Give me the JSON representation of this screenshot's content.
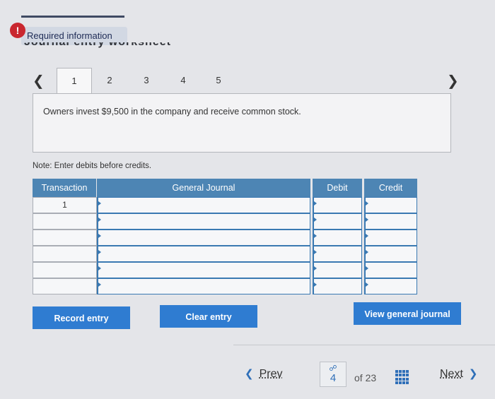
{
  "alert": {
    "icon": "exclamation-icon",
    "label": "!",
    "tab_label": "Required information"
  },
  "worksheet": {
    "heading": "Journal entry worksheet",
    "prev_icon": "chevron-left-icon",
    "next_icon": "chevron-right-icon",
    "steps": [
      "1",
      "2",
      "3",
      "4",
      "5"
    ],
    "active_step": "1",
    "prompt": "Owners invest $9,500 in the company and receive common stock.",
    "note": "Note: Enter debits before credits."
  },
  "journal": {
    "headers": {
      "transaction": "Transaction",
      "general_journal": "General Journal",
      "debit": "Debit",
      "credit": "Credit"
    },
    "rows": [
      {
        "transaction": "1",
        "account": "",
        "debit": "",
        "credit": ""
      },
      {
        "transaction": "",
        "account": "",
        "debit": "",
        "credit": ""
      },
      {
        "transaction": "",
        "account": "",
        "debit": "",
        "credit": ""
      },
      {
        "transaction": "",
        "account": "",
        "debit": "",
        "credit": ""
      },
      {
        "transaction": "",
        "account": "",
        "debit": "",
        "credit": ""
      },
      {
        "transaction": "",
        "account": "",
        "debit": "",
        "credit": ""
      }
    ]
  },
  "buttons": {
    "record": "Record entry",
    "clear": "Clear entry",
    "view": "View general journal"
  },
  "pagination": {
    "prev": "Prev",
    "current_page": "4",
    "of_text": "of 23",
    "next": "Next",
    "link_icon": "link-icon",
    "grid_icon": "grid-icon"
  },
  "colors": {
    "primary_button": "#2f7cd1",
    "table_header": "#4d85b4",
    "alert": "#c9272f"
  }
}
